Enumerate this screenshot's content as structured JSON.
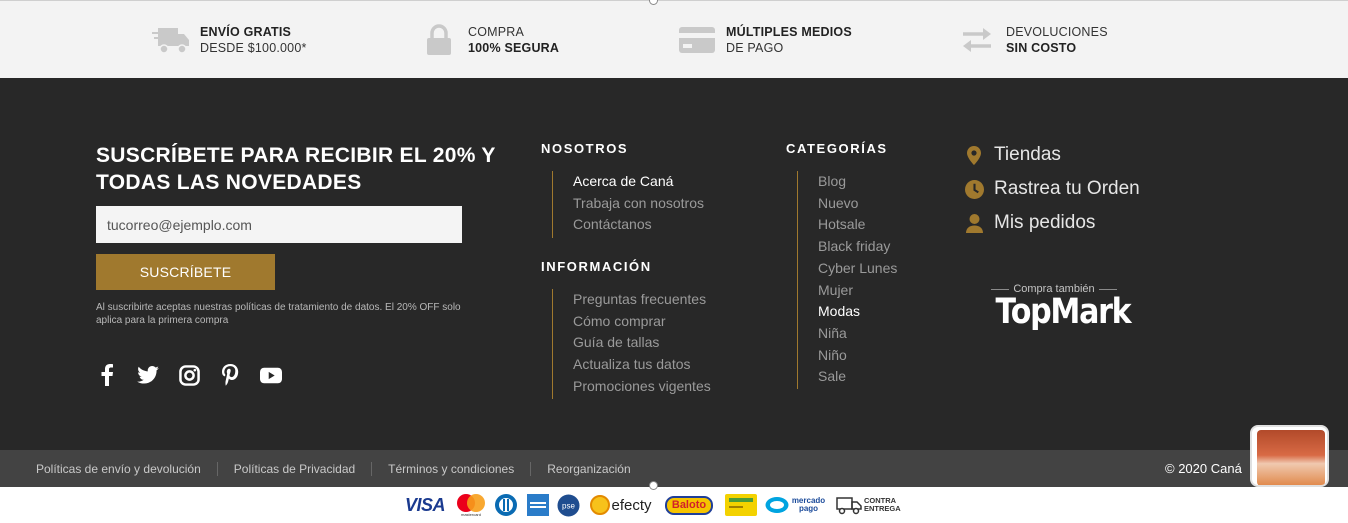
{
  "benefits": [
    {
      "icon": "truck-icon",
      "line1": "ENVÍO GRATIS",
      "line2": "DESDE $100.000*",
      "bold_first": true
    },
    {
      "icon": "lock-icon",
      "line1": "COMPRA",
      "line2": "100% SEGURA",
      "bold_first": false
    },
    {
      "icon": "credit-card-icon",
      "line1": "MÚLTIPLES MEDIOS",
      "line2": "DE PAGO",
      "bold_first": true
    },
    {
      "icon": "exchange-arrows-icon",
      "line1": "DEVOLUCIONES",
      "line2": "SIN COSTO",
      "bold_first": false
    }
  ],
  "subscribe": {
    "title": "SUSCRÍBETE PARA RECIBIR EL 20% Y TODAS LAS NOVEDADES",
    "email_placeholder": "tucorreo@ejemplo.com",
    "button_label": "SUSCRÍBETE",
    "disclaimer": "Al suscribirte aceptas nuestras políticas de tratamiento de datos. El 20% OFF solo aplica para la primera compra"
  },
  "socials": [
    "facebook-icon",
    "twitter-icon",
    "instagram-icon",
    "pinterest-icon",
    "youtube-icon"
  ],
  "nosotros": {
    "title": "NOSOTROS",
    "items": [
      "Acerca de Caná",
      "Trabaja con nosotros",
      "Contáctanos"
    ]
  },
  "informacion": {
    "title": "INFORMACIÓN",
    "items": [
      "Preguntas frecuentes",
      "Cómo comprar",
      "Guía de tallas",
      "Actualiza tus datos",
      "Promociones vigentes"
    ]
  },
  "categorias": {
    "title": "CATEGORÍAS",
    "items": [
      "Blog",
      "Nuevo",
      "Hotsale",
      "Black friday",
      "Cyber Lunes",
      "Mujer",
      "Modas",
      "Niña",
      "Niño",
      "Sale"
    ]
  },
  "quick_links": [
    {
      "icon": "map-pin-icon",
      "label": "Tiendas"
    },
    {
      "icon": "clock-icon",
      "label": "Rastrea tu Orden"
    },
    {
      "icon": "user-icon",
      "label": "Mis pedidos"
    }
  ],
  "also_buy": {
    "label": "Compra también",
    "brand": "TopMark"
  },
  "legal": {
    "links": [
      "Políticas de envío y devolución",
      "Políticas de Privacidad",
      "Términos y condiciones",
      "Reorganización"
    ],
    "copyright": "© 2020 Caná"
  },
  "payments": {
    "visa": "VISA",
    "mastercard": "mastercard",
    "pse": "pse",
    "efecty": "efecty",
    "baloto": "Baloto",
    "mercadopago": "mercado pago",
    "contra_entrega": "CONTRA ENTREGA"
  },
  "colors": {
    "accent": "#a0792e",
    "footer_bg": "#282828",
    "legal_bg": "#434343"
  }
}
